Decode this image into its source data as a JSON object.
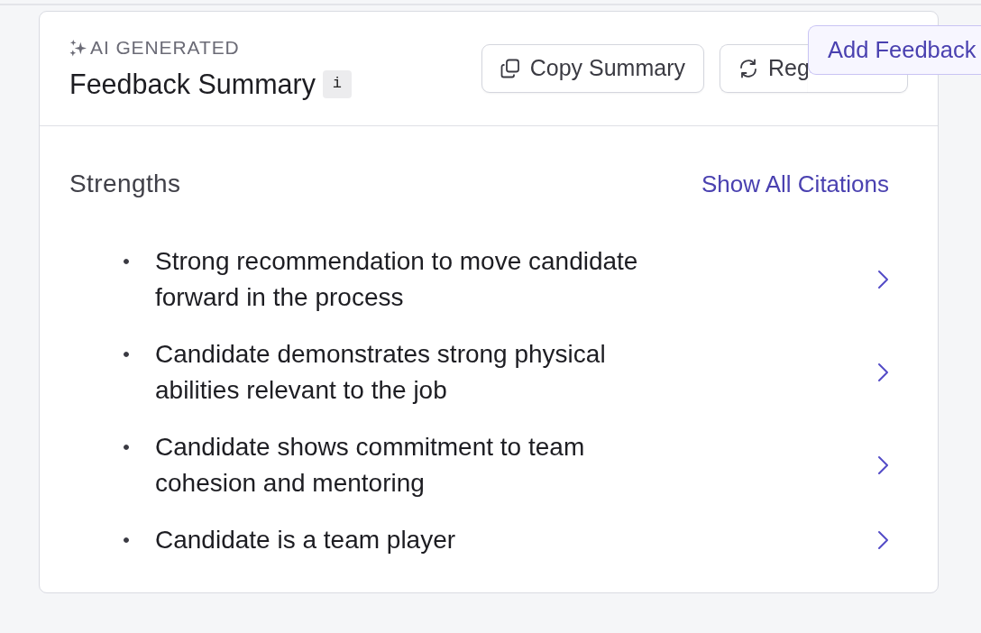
{
  "header": {
    "eyebrow": "AI GENERATED",
    "title": "Feedback Summary",
    "info_badge": "i",
    "buttons": [
      {
        "label": "Copy Summary",
        "kind": "copy"
      },
      {
        "label": "Reg",
        "kind": "refresh"
      }
    ]
  },
  "popover": {
    "label": "Add Feedback"
  },
  "section": {
    "title": "Strengths",
    "link": "Show All Citations",
    "items": [
      {
        "text": "Strong recommendation to move candidate forward in the process"
      },
      {
        "text": "Candidate demonstrates strong physical abilities relevant to the job"
      },
      {
        "text": "Candidate shows commitment to team cohesion and mentoring"
      },
      {
        "text": "Candidate is a team player"
      }
    ]
  }
}
